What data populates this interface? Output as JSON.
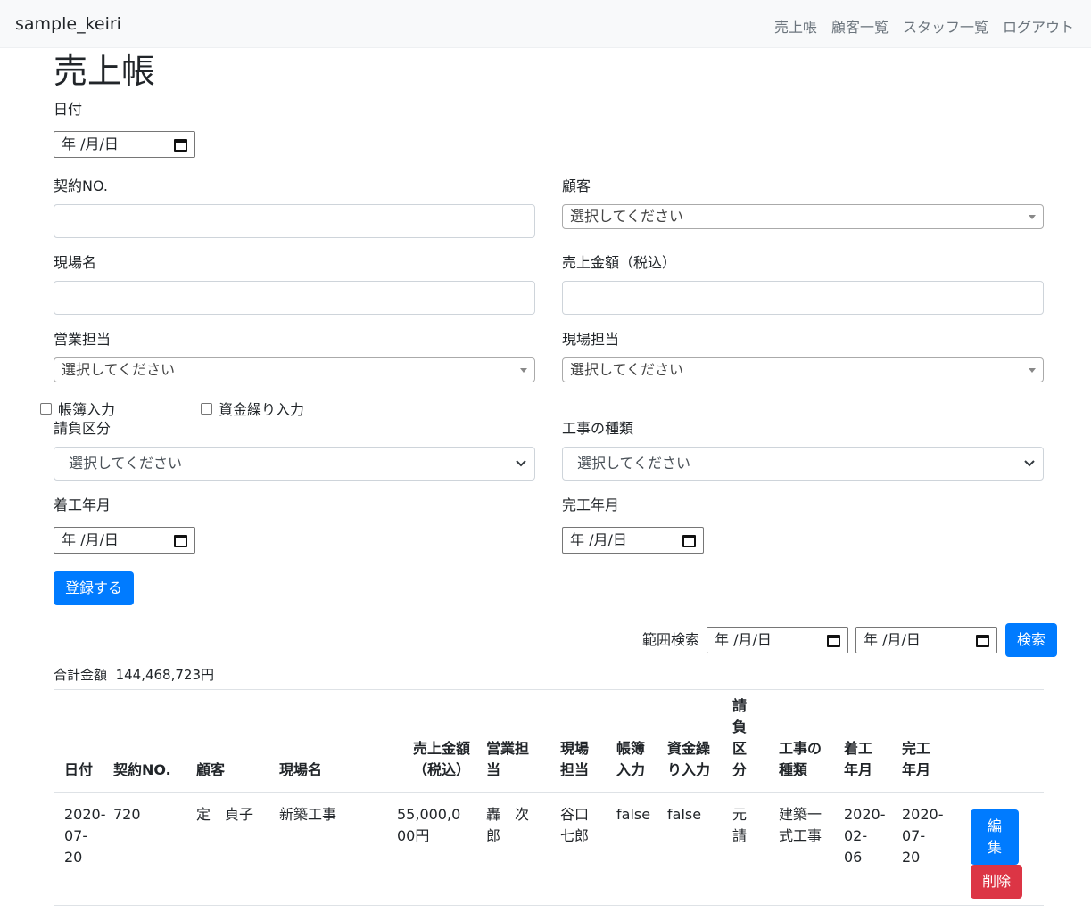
{
  "navbar": {
    "brand": "sample_keiri",
    "links": [
      "売上帳",
      "顧客一覧",
      "スタッフ一覧",
      "ログアウト"
    ]
  },
  "page_title": "売上帳",
  "form": {
    "date_label": "日付",
    "date_placeholder": "年 /月/日",
    "contract_no_label": "契約NO.",
    "customer_label": "顧客",
    "customer_placeholder": "選択してください",
    "site_name_label": "現場名",
    "sales_amount_label": "売上金額（税込）",
    "sales_staff_label": "営業担当",
    "sales_staff_placeholder": "選択してください",
    "site_staff_label": "現場担当",
    "site_staff_placeholder": "選択してください",
    "ledger_checkbox_label": "帳簿入力",
    "cashflow_checkbox_label": "資金繰り入力",
    "contract_type_label": "請負区分",
    "contract_type_placeholder": "選択してください",
    "work_type_label": "工事の種類",
    "work_type_placeholder": "選択してください",
    "start_month_label": "着工年月",
    "start_month_placeholder": "年 /月/日",
    "end_month_label": "完工年月",
    "end_month_placeholder": "年 /月/日",
    "submit_label": "登録する"
  },
  "range_search": {
    "label": "範囲検索",
    "from_placeholder": "年 /月/日",
    "to_placeholder": "年 /月/日",
    "button_label": "検索"
  },
  "total": {
    "label": "合計金額",
    "value": "144,468,723円"
  },
  "table": {
    "headers": [
      "日付",
      "契約NO.",
      "顧客",
      "現場名",
      "売上金額（税込）",
      "営業担当",
      "現場担当",
      "帳簿入力",
      "資金繰り入力",
      "請負区分",
      "工事の種類",
      "着工年月",
      "完工年月"
    ],
    "rows": [
      {
        "date": "2020-07-20",
        "contract_no": "720",
        "customer": "定　貞子",
        "site_name": "新築工事",
        "amount": "55,000,000円",
        "sales_staff": "轟　次郎",
        "site_staff": "谷口　七郎",
        "ledger": "false",
        "cashflow": "false",
        "contract_type": "元請",
        "work_type": "建築一式工事",
        "start": "2020-02-06",
        "end": "2020-07-20",
        "edit_label": "編集",
        "delete_label": "削除"
      }
    ]
  },
  "colors": {
    "primary": "#007bff",
    "danger": "#dc3545",
    "navbar_bg": "#f8f9fa"
  }
}
